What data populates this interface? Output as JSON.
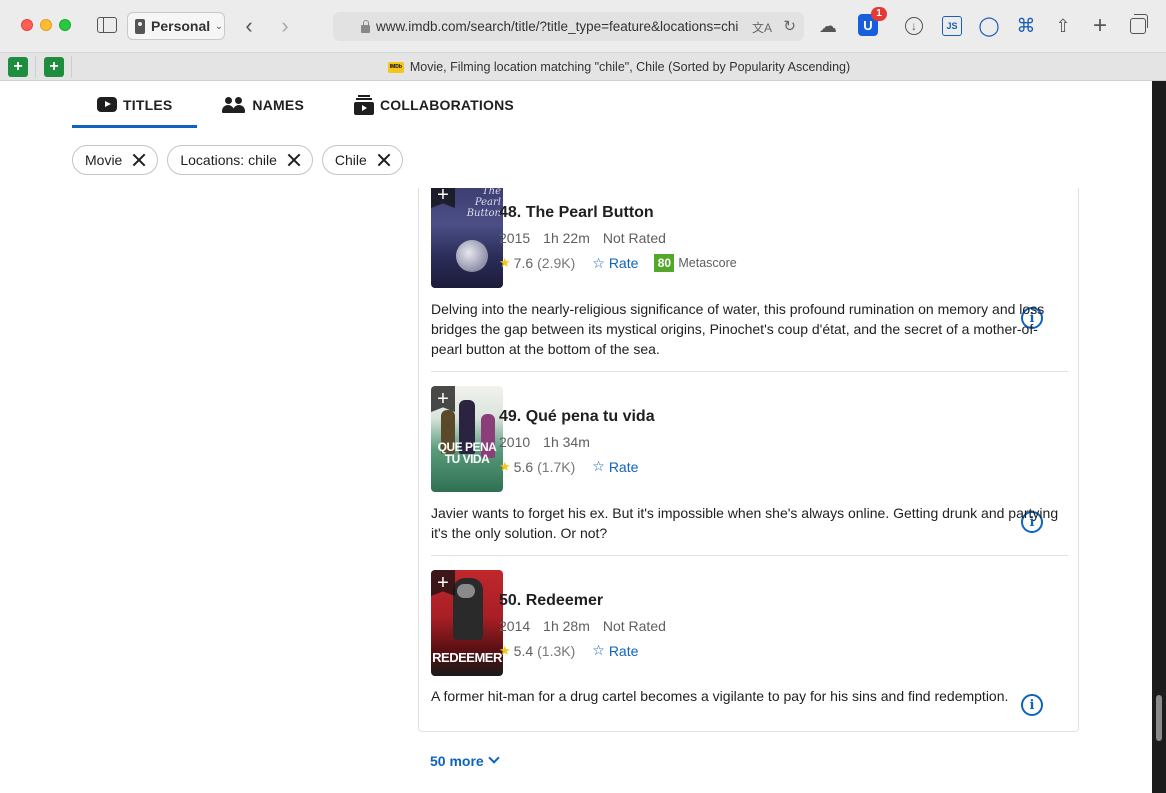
{
  "browser": {
    "profile": "Personal",
    "url": "www.imdb.com/search/title/?title_type=feature&locations=chi",
    "tab_title": "Movie, Filming location matching \"chile\", Chile (Sorted by Popularity Ascending)",
    "bitwarden_badge": "1",
    "js_label": "JS",
    "imdb_favicon": "IMDb"
  },
  "tabs": [
    {
      "label": "TITLES",
      "icon": "video-icon",
      "active": true
    },
    {
      "label": "NAMES",
      "icon": "people-icon",
      "active": false
    },
    {
      "label": "COLLABORATIONS",
      "icon": "collaborations-icon",
      "active": false
    }
  ],
  "filters": [
    {
      "label": "Movie"
    },
    {
      "label": "Locations: chile"
    },
    {
      "label": "Chile"
    }
  ],
  "results": [
    {
      "title": "48. The Pearl Button",
      "year": "2015",
      "runtime": "1h 22m",
      "certificate": "Not Rated",
      "rating": "7.6",
      "votes": "(2.9K)",
      "rate_label": "Rate",
      "metascore": "80",
      "metascore_label": "Metascore",
      "plot": "Delving into the nearly-religious significance of water, this profound rumination on memory and loss bridges the gap between its mystical origins, Pinochet's coup d'état, and the secret of a mother-of-pearl button at the bottom of the sea.",
      "poster_text": "The Pearl Button"
    },
    {
      "title": "49. Qué pena tu vida",
      "year": "2010",
      "runtime": "1h 34m",
      "rating": "5.6",
      "votes": "(1.7K)",
      "rate_label": "Rate",
      "plot": "Javier wants to forget his ex. But it's impossible when she's always online. Getting drunk and partying it's the only solution. Or not?",
      "poster_text": "QUE PENA TU VIDA"
    },
    {
      "title": "50. Redeemer",
      "year": "2014",
      "runtime": "1h 28m",
      "certificate": "Not Rated",
      "rating": "5.4",
      "votes": "(1.3K)",
      "rate_label": "Rate",
      "plot": "A former hit-man for a drug cartel becomes a vigilante to pay for his sins and find redemption.",
      "poster_text": "REDEEMER"
    }
  ],
  "more_label": "50 more",
  "colors": {
    "accent": "#0e63be",
    "star": "#f5c518",
    "metascore_green": "#54a72a"
  }
}
